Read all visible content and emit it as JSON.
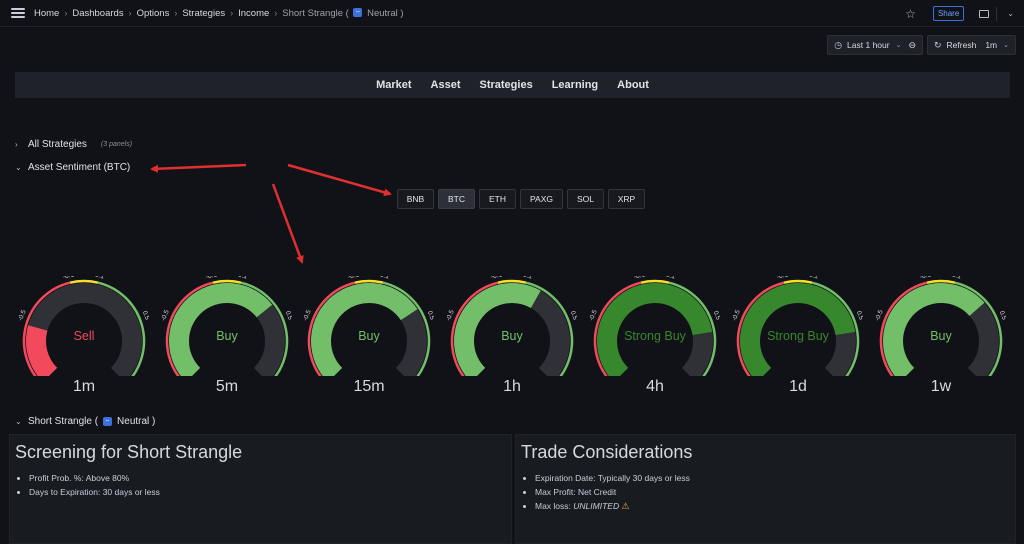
{
  "breadcrumbs": [
    "Home",
    "Dashboards",
    "Options",
    "Strategies",
    "Income"
  ],
  "breadcrumb_last": {
    "prefix": "Short Strangle (",
    "icon": "strategy-badge-icon",
    "badge_text": "⇔",
    "text": "Neutral )"
  },
  "topbar": {
    "share_label": "Share",
    "star_icon": "star-icon",
    "monitor_icon": "tv-mode-icon"
  },
  "time": {
    "range_label": "Last 1 hour",
    "refresh_label": "Refresh",
    "refresh_interval": "1m"
  },
  "nav": [
    "Market",
    "Asset",
    "Strategies",
    "Learning",
    "About"
  ],
  "rows": {
    "all_strategies": {
      "title": "All Strategies",
      "count": "(3 panels)"
    },
    "asset_sentiment": {
      "title": "Asset Sentiment (BTC)"
    },
    "short_strangle": {
      "prefix": "Short Strangle (",
      "badge_text": "⇔",
      "suffix": "Neutral )"
    }
  },
  "assets": {
    "options": [
      "BNB",
      "BTC",
      "ETH",
      "PAXG",
      "SOL",
      "XRP"
    ],
    "selected": "BTC"
  },
  "gauge_ticks": [
    "-1",
    "-0.5",
    "-0.1",
    "0.1",
    "0.5",
    "1"
  ],
  "gauges": [
    {
      "period": "1m",
      "label": "Sell",
      "value": -0.55,
      "fill_color": "#f2495c",
      "label_color": "#f2495c"
    },
    {
      "period": "5m",
      "label": "Buy",
      "value": 0.38,
      "fill_color": "#73bf69",
      "label_color": "#73bf69"
    },
    {
      "period": "15m",
      "label": "Buy",
      "value": 0.42,
      "fill_color": "#73bf69",
      "label_color": "#73bf69"
    },
    {
      "period": "1h",
      "label": "Buy",
      "value": 0.22,
      "fill_color": "#73bf69",
      "label_color": "#73bf69"
    },
    {
      "period": "4h",
      "label": "Strong Buy",
      "value": 0.6,
      "fill_color": "#37872d",
      "label_color": "#37872d"
    },
    {
      "period": "1d",
      "label": "Strong Buy",
      "value": 0.6,
      "fill_color": "#37872d",
      "label_color": "#37872d"
    },
    {
      "period": "1w",
      "label": "Buy",
      "value": 0.36,
      "fill_color": "#73bf69",
      "label_color": "#73bf69"
    }
  ],
  "panels": {
    "screening": {
      "title": "Screening for Short Strangle",
      "items": [
        "Profit Prob. %: Above 80%",
        "Days to Expiration: 30 days or less"
      ]
    },
    "trade": {
      "title": "Trade Considerations",
      "items": [
        {
          "label": "Expiration Date:",
          "value": "Typically 30 days or less"
        },
        {
          "label": "Max Profit:",
          "value": "Net Credit"
        },
        {
          "label": "Max loss:",
          "value": "UNLIMITED"
        }
      ],
      "warn_icon": "⚠"
    }
  },
  "colors": {
    "accent": "#3d71d9",
    "annotation_arrow": "#e02f2f"
  }
}
